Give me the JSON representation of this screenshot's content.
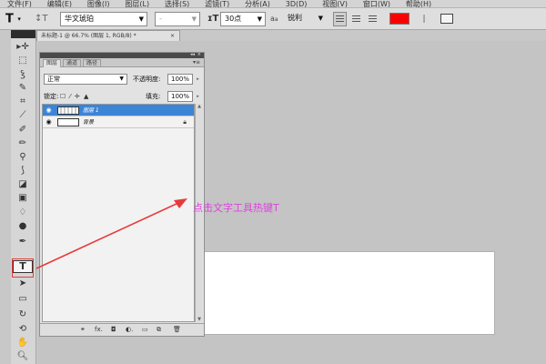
{
  "menubar": {
    "items": [
      "文件(F)",
      "编辑(E)",
      "图像(I)",
      "图层(L)",
      "选择(S)",
      "滤镜(T)",
      "分析(A)",
      "3D(D)",
      "视图(V)",
      "窗口(W)",
      "帮助(H)"
    ]
  },
  "options_bar": {
    "tool_icon": "T",
    "font_family": "华文琥珀",
    "font_style": "-",
    "font_size": "30点",
    "antialias_icon": "a",
    "antialias": "锐利",
    "text_color": "#ff0000",
    "icons": [
      "text-tool-icon",
      "text-orientation-icon",
      "font-size-icon",
      "antialias-icon",
      "align-left-icon",
      "align-center-icon",
      "align-right-icon",
      "warp-text-icon",
      "character-panel-icon"
    ]
  },
  "document": {
    "tab_title": "未标题-1 @ 66.7% (图层 1, RGB/8) *",
    "tab_close": "×"
  },
  "layers_panel": {
    "tabs": [
      "图层",
      "通道",
      "路径"
    ],
    "blend_mode": "正常",
    "opacity_label": "不透明度:",
    "opacity_value": "100%",
    "lock_label": "锁定:",
    "fill_label": "填充:",
    "fill_value": "100%",
    "layers": [
      {
        "name": "图层 1",
        "selected": true
      },
      {
        "name": "背景",
        "selected": false
      }
    ],
    "footer_icons": [
      "link-layers-icon",
      "layer-style-icon",
      "layer-mask-icon",
      "adjustment-layer-icon",
      "group-icon",
      "new-layer-icon",
      "delete-layer-icon"
    ]
  },
  "annotation": {
    "text": "点击文字工具热键T",
    "color": "#e040e0"
  },
  "tools": [
    "move-tool-icon",
    "marquee-tool-icon",
    "lasso-tool-icon",
    "quick-select-tool-icon",
    "crop-tool-icon",
    "eyedropper-tool-icon",
    "healing-brush-tool-icon",
    "brush-tool-icon",
    "clone-stamp-tool-icon",
    "history-brush-tool-icon",
    "eraser-tool-icon",
    "gradient-tool-icon",
    "blur-tool-icon",
    "dodge-tool-icon",
    "pen-tool-icon",
    "text-tool-icon",
    "path-select-tool-icon",
    "shape-tool-icon",
    "3d-rotate-tool-icon",
    "3d-camera-tool-icon",
    "hand-tool-icon",
    "zoom-tool-icon"
  ],
  "active_tool": {
    "label": "T",
    "highlight_color": "#e83a3a"
  }
}
